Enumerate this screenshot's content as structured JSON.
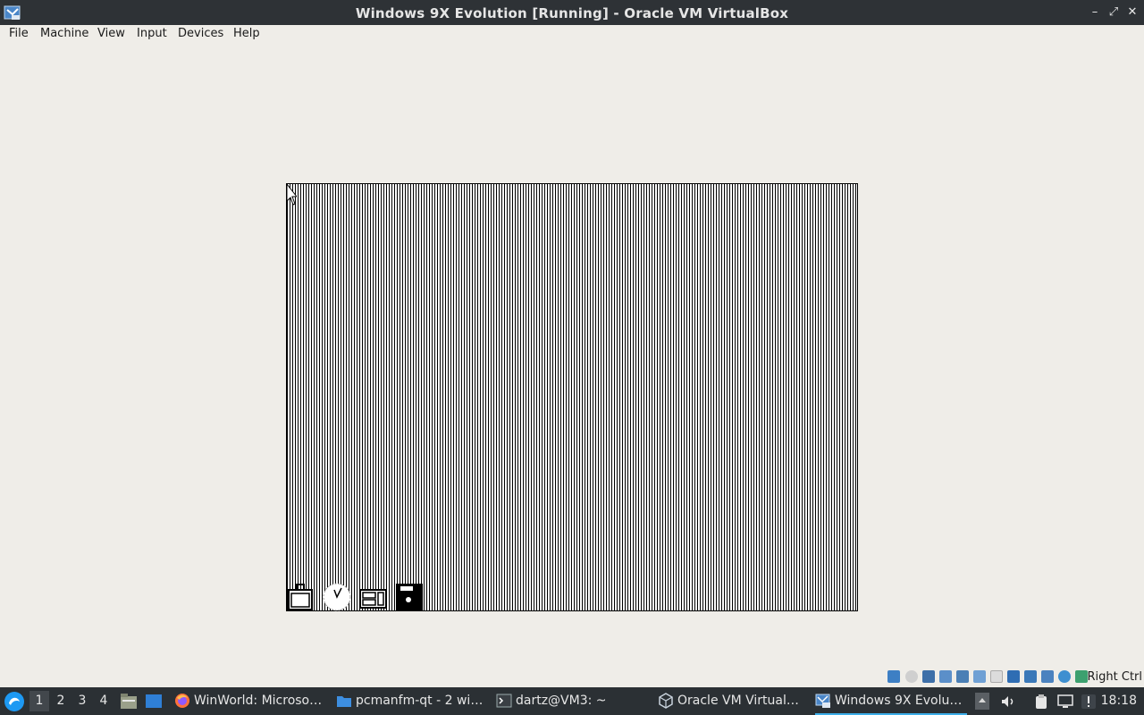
{
  "window": {
    "title": "Windows 9X Evolution [Running] - Oracle VM VirtualBox",
    "minimize_glyph": "–",
    "maximize_glyph": "⤢",
    "close_glyph": "✕"
  },
  "menubar": {
    "items": [
      "File",
      "Machine",
      "View",
      "Input",
      "Devices",
      "Help"
    ]
  },
  "vm_screen": {
    "icons": [
      "briefcase-icon",
      "clock-icon",
      "cabinet-icon",
      "disk-icon"
    ]
  },
  "status_bar": {
    "icons": [
      "hard-disk-icon",
      "optical-drive-icon",
      "floppy-icon",
      "audio-icon",
      "network-icon",
      "usb-icon",
      "shared-folders-icon",
      "display-icon",
      "video-capture-icon",
      "cpu-icon",
      "mouse-integration-icon",
      "keyboard-icon"
    ],
    "host_key": "Right Ctrl"
  },
  "taskbar": {
    "desktops": [
      "1",
      "2",
      "3",
      "4"
    ],
    "active_desktop": "1",
    "tasks": [
      {
        "label": "WinWorld: Microso…",
        "icon": "firefox-icon"
      },
      {
        "label": "pcmanfm-qt - 2 wi…",
        "icon": "folder-icon"
      },
      {
        "label": "dartz@VM3: ~",
        "icon": "terminal-icon"
      },
      {
        "label": "Oracle VM Virtual…",
        "icon": "virtualbox-icon"
      },
      {
        "label": "Windows 9X Evolu…",
        "icon": "vm-window-icon",
        "active": true
      }
    ],
    "tray_icons": [
      "volume-icon",
      "clipboard-icon",
      "network-tray-icon",
      "notification-icon"
    ],
    "clock": "18:18"
  },
  "colors": {
    "titlebar_bg": "#2e3236",
    "taskbar_bg": "#2b3034",
    "accent": "#3daee9",
    "window_bg": "#efede8"
  }
}
